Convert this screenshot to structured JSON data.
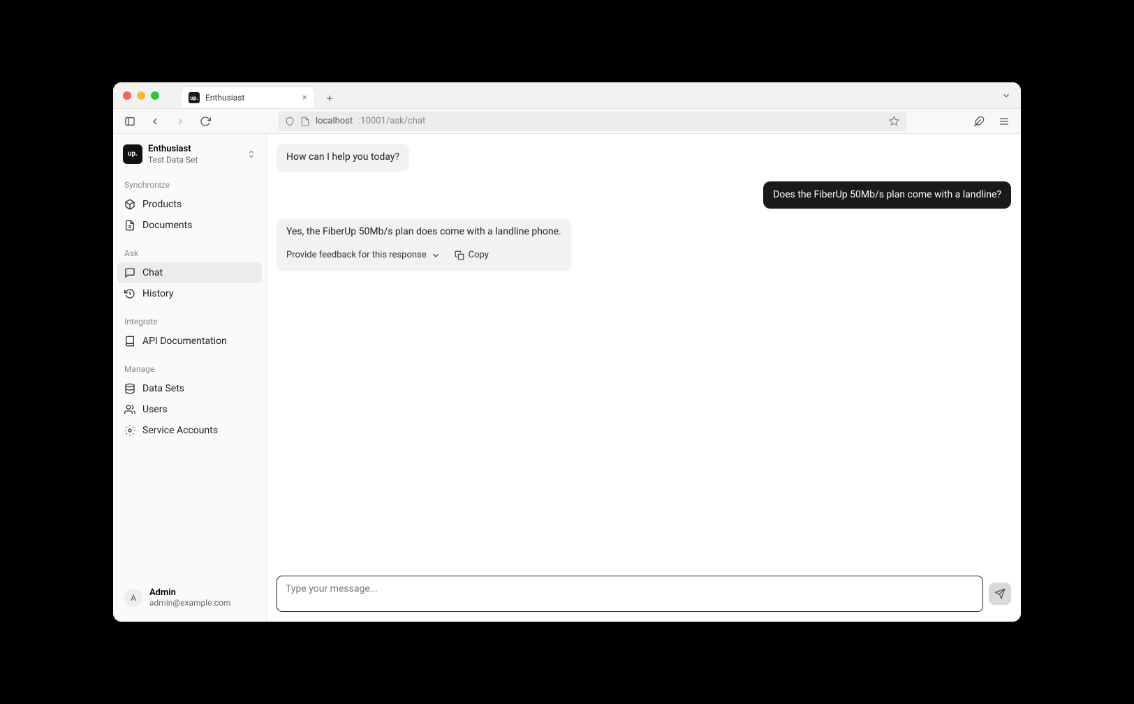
{
  "browser": {
    "tab_title": "Enthusiast",
    "url_host": "localhost",
    "url_path": ":10001/ask/chat"
  },
  "workspace": {
    "name": "Enthusiast",
    "dataset": "Test Data Set",
    "logo_text": "up."
  },
  "sidebar": {
    "sections": {
      "synchronize": {
        "label": "Synchronize"
      },
      "ask": {
        "label": "Ask"
      },
      "integrate": {
        "label": "Integrate"
      },
      "manage": {
        "label": "Manage"
      }
    },
    "items": {
      "products": "Products",
      "documents": "Documents",
      "chat": "Chat",
      "history": "History",
      "api_docs": "API Documentation",
      "data_sets": "Data Sets",
      "users": "Users",
      "service_accounts": "Service Accounts"
    }
  },
  "user": {
    "initial": "A",
    "name": "Admin",
    "email": "admin@example.com"
  },
  "chat": {
    "messages": {
      "greeting": "How can I help you today?",
      "user_q": "Does the FiberUp 50Mb/s plan come with a landline?",
      "answer": "Yes, the FiberUp 50Mb/s plan does come with a landline phone."
    },
    "actions": {
      "feedback": "Provide feedback for this response",
      "copy": "Copy"
    },
    "composer_placeholder": "Type your message..."
  }
}
